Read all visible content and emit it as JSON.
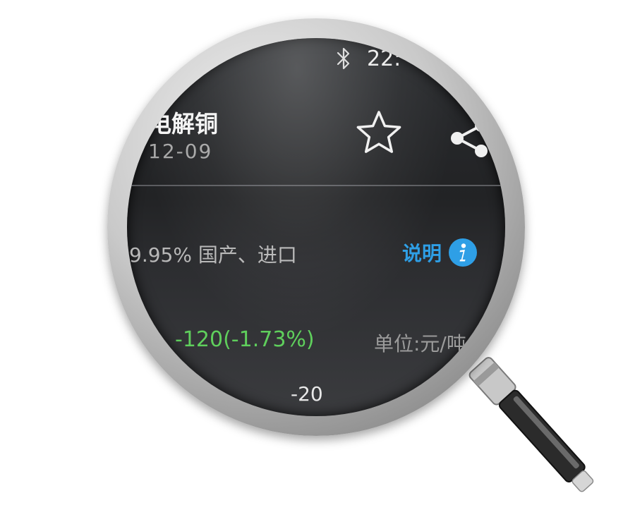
{
  "status_bar": {
    "bluetooth_icon": "bluetooth-icon",
    "time_partial": "22:"
  },
  "header": {
    "title_partial": "电解铜",
    "date_partial": "12-09",
    "favorite_icon": "star-icon",
    "share_icon": "share-icon"
  },
  "product": {
    "spec_partial": "9.95% 国产、进口",
    "info_label": "说明",
    "info_icon": "info-icon"
  },
  "quote": {
    "change": "-120(-1.73%)",
    "unit_partial": "单位:元/吨"
  },
  "chart": {
    "axis_tick": "-20"
  },
  "colors": {
    "background": "#2b2d30",
    "accent_blue": "#2e9fe6",
    "change_green": "#5fcf5c",
    "text_primary": "#f4f4f4",
    "text_secondary": "#a6a6a6"
  }
}
